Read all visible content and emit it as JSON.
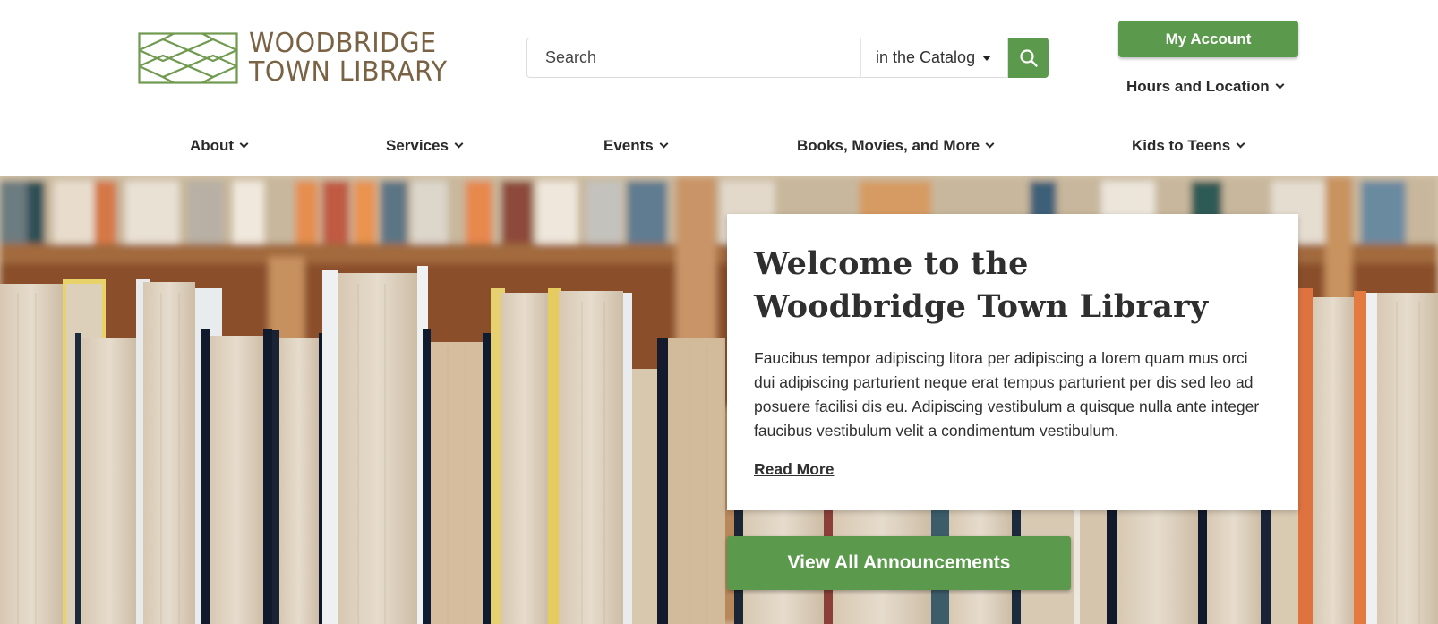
{
  "header": {
    "logo": {
      "line1": "WOODBRIDGE",
      "line2": "TOWN LIBRARY",
      "color": "#7a6244",
      "mark_color": "#6f9a4f"
    },
    "search": {
      "placeholder": "Search",
      "scope_selected": "in the Catalog",
      "button_icon": "search-icon"
    },
    "account_label": "My Account",
    "hours_label": "Hours and Location"
  },
  "nav": {
    "items": [
      {
        "label": "About"
      },
      {
        "label": "Services"
      },
      {
        "label": "Events"
      },
      {
        "label": "Books, Movies, and More"
      },
      {
        "label": "Kids to Teens"
      }
    ]
  },
  "hero": {
    "title_line1": "Welcome to the",
    "title_line2": "Woodbridge Town Library",
    "body": "Faucibus tempor adipiscing litora per adipiscing a lorem quam mus orci dui adipiscing parturient neque erat tempus parturient per dis sed leo ad posuere facilisi dis eu. Adipiscing vestibulum a quisque nulla ante integer faucibus vestibulum velit a condimentum vestibulum.",
    "read_more": "Read More",
    "announcements_button": "View All Announcements"
  },
  "colors": {
    "accent": "#5b9a4c",
    "text": "#2f2f2f"
  }
}
